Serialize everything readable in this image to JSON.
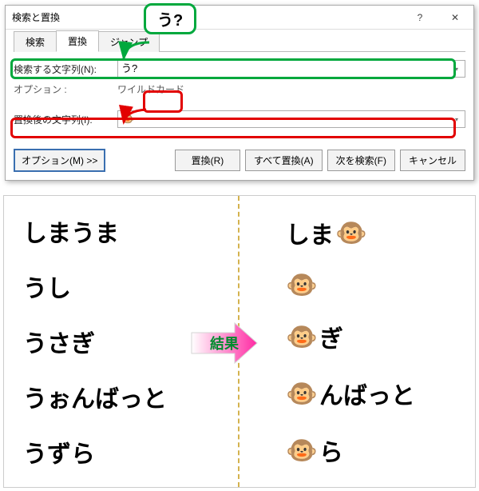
{
  "dialog": {
    "title": "検索と置換",
    "help_icon": "?",
    "close_icon": "✕",
    "tabs": {
      "search": "検索",
      "replace": "置換",
      "jump": "ジャンプ"
    },
    "active_tab": "replace",
    "find": {
      "label": "検索する文字列(N):",
      "value": "う?"
    },
    "options": {
      "label": "オプション :",
      "value": "ワイルドカード"
    },
    "replace": {
      "label": "置換後の文字列(I):",
      "value": "🐵"
    },
    "buttons": {
      "options": "オプション(M) >>",
      "replace": "置換(R)",
      "replace_all": "すべて置換(A)",
      "find_next": "次を検索(F)",
      "cancel": "キャンセル"
    }
  },
  "callout": {
    "text": "う?"
  },
  "result": {
    "label": "結果",
    "before": [
      "しまうま",
      "うし",
      "うさぎ",
      "うぉんばっと",
      "うずら"
    ],
    "after": [
      {
        "monkey": false,
        "pre": "しま",
        "suf": ""
      },
      {
        "monkey": true,
        "pre": "",
        "suf": ""
      },
      {
        "monkey": true,
        "pre": "",
        "suf": "ぎ"
      },
      {
        "monkey": true,
        "pre": "",
        "suf": "んばっと"
      },
      {
        "monkey": true,
        "pre": "",
        "suf": "ら"
      }
    ],
    "monkey": "🐵"
  }
}
